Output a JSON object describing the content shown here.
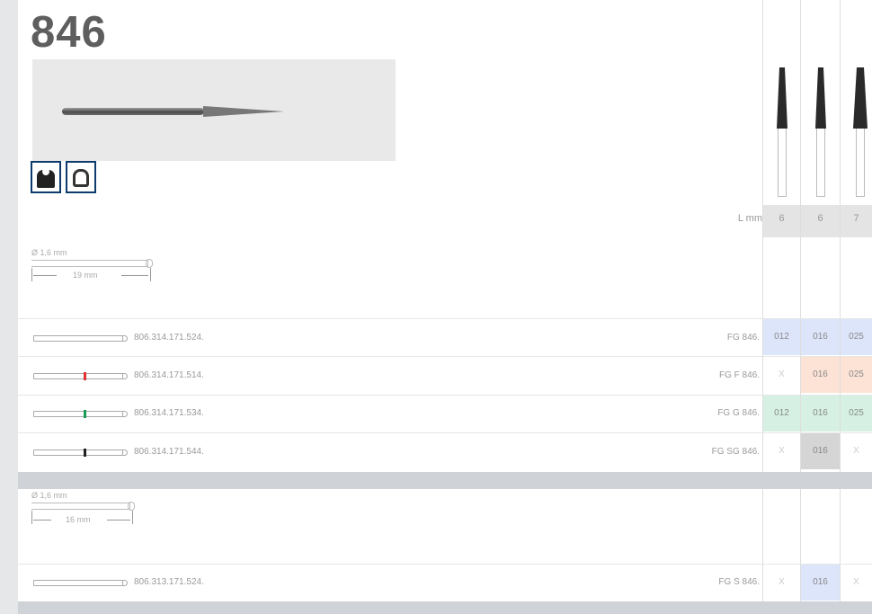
{
  "title": "846",
  "icons": [
    "tooth-solid-icon",
    "tooth-outline-icon"
  ],
  "lmm_label": "L mm",
  "lengths": [
    "6",
    "6",
    "7"
  ],
  "shank1": {
    "diameter": "Ø 1,6 mm",
    "length": "19 mm"
  },
  "shank2": {
    "diameter": "Ø 1,6 mm",
    "length": "16 mm"
  },
  "rows": [
    {
      "code": "806.314.171.524.",
      "name": "FG 846.",
      "ring": "none",
      "sizes": [
        "012",
        "016",
        "025"
      ],
      "bg": [
        "#dde5fb",
        "#dde5fb",
        "#dde5fb"
      ]
    },
    {
      "code": "806.314.171.514.",
      "name": "FG F 846.",
      "ring": "#d33",
      "sizes": [
        "X",
        "016",
        "025"
      ],
      "bg": [
        "#ffffff",
        "#fde3d6",
        "#fde3d6"
      ]
    },
    {
      "code": "806.314.171.534.",
      "name": "FG G 846.",
      "ring": "#1a9c55",
      "sizes": [
        "012",
        "016",
        "025"
      ],
      "bg": [
        "#d6f1e3",
        "#d6f1e3",
        "#d6f1e3"
      ]
    },
    {
      "code": "806.314.171.544.",
      "name": "FG SG 846.",
      "ring": "#222",
      "sizes": [
        "X",
        "016",
        "X"
      ],
      "bg": [
        "#ffffff",
        "#d5d5d5",
        "#ffffff"
      ]
    }
  ],
  "row5": {
    "code": "806.313.171.524.",
    "name": "FG S 846.",
    "sizes": [
      "X",
      "016",
      "X"
    ],
    "bg": [
      "#ffffff",
      "#dde5fb",
      "#ffffff"
    ]
  }
}
